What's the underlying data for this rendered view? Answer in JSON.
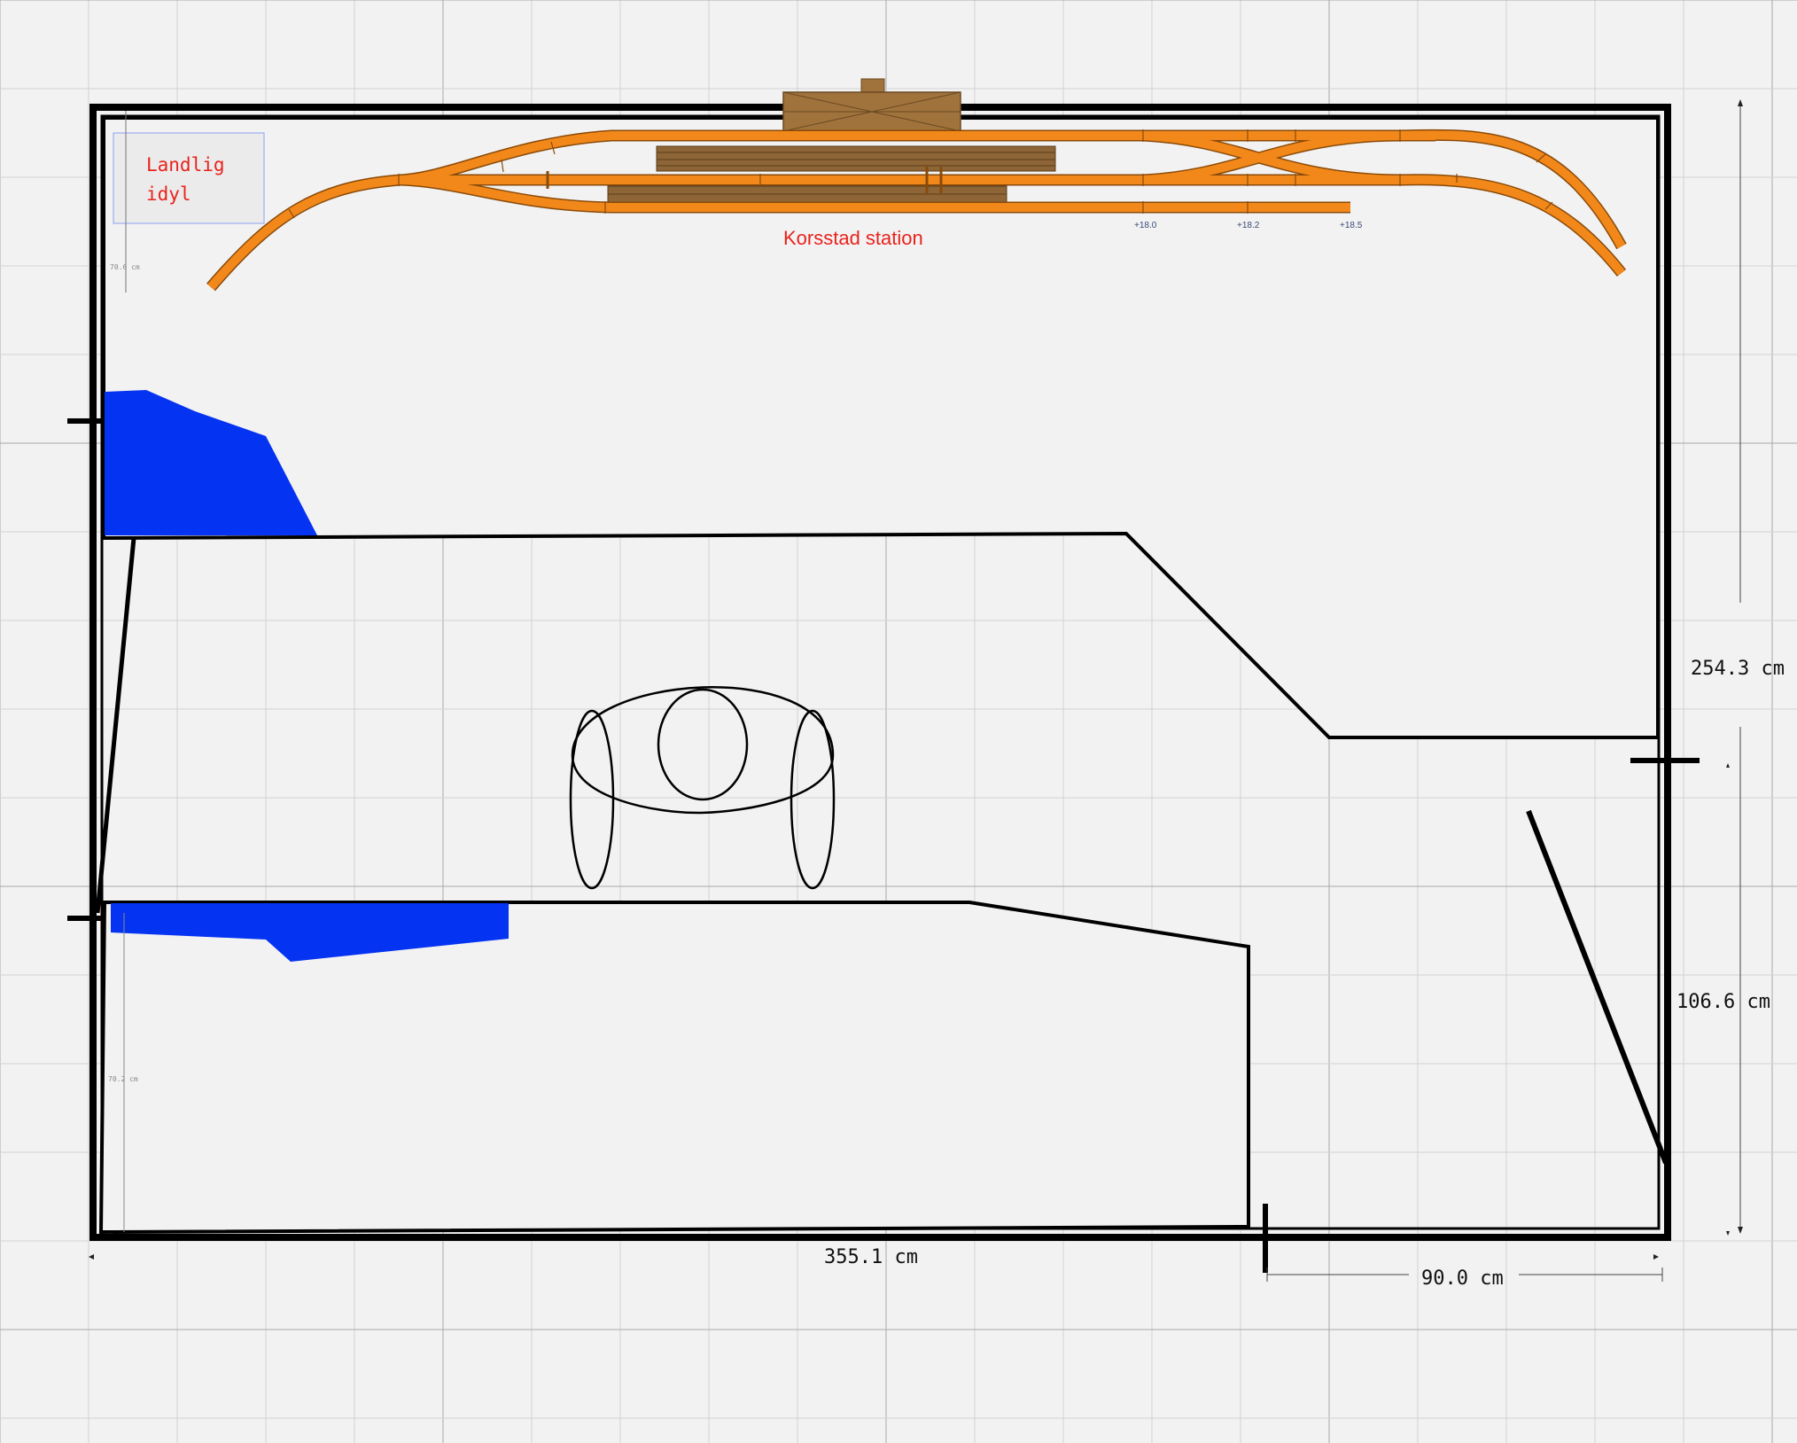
{
  "labels": {
    "area_note_line1": "Landlig",
    "area_note_line2": "idyl",
    "station_name": "Korsstad station",
    "elev_1": "+18.0",
    "elev_2": "+18.2",
    "elev_3": "+18.5",
    "small_dim_top": "70.6 cm",
    "small_dim_bottom": "70.2 cm"
  },
  "dimensions": {
    "width_total": "355.1 cm",
    "height_total": "254.3 cm",
    "door_right": "106.6 cm",
    "door_bottom": "90.0 cm"
  },
  "colors": {
    "background": "#f2f2f2",
    "grid_minor": "#d2d2d2",
    "grid_major": "#a8a8a8",
    "wall": "#000000",
    "track": "#f2881a",
    "track_edge": "#8a4a08",
    "building": "#a0723c",
    "water": "#0533f2",
    "label_red": "#e8231d",
    "elev_blue": "#3a4a7a"
  }
}
